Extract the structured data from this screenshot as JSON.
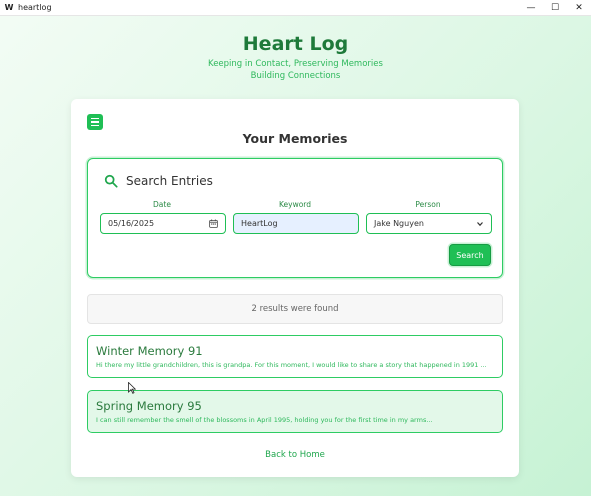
{
  "window": {
    "title": "heartlog",
    "app_icon_glyph": "W",
    "controls": [
      "—",
      "☐",
      "✕"
    ]
  },
  "header": {
    "title": "Heart Log",
    "tagline_line1": "Keeping in Contact, Preserving Memories",
    "tagline_line2": "Building Connections"
  },
  "card": {
    "title": "Your Memories"
  },
  "search": {
    "title": "Search Entries",
    "date_label": "Date",
    "date_value": "05/16/2025",
    "keyword_label": "Keyword",
    "keyword_value": "HeartLog",
    "person_label": "Person",
    "person_value": "Jake Nguyen",
    "button_label": "Search"
  },
  "results": {
    "summary": "2 results were found",
    "entries": [
      {
        "title": "Winter Memory 91",
        "snippet": "Hi there my little grandchildren, this is grandpa. For this moment, I would like to share a story that happened in 1991 ..."
      },
      {
        "title": "Spring Memory 95",
        "snippet": "I can still remember the smell of the blossoms in April 1995, holding you for the first time in my arms..."
      }
    ]
  },
  "footer": {
    "back_link": "Back to Home"
  },
  "colors": {
    "accent": "#1fbf55",
    "title_green": "#1e7a3a",
    "text_green": "#2eb85c"
  }
}
